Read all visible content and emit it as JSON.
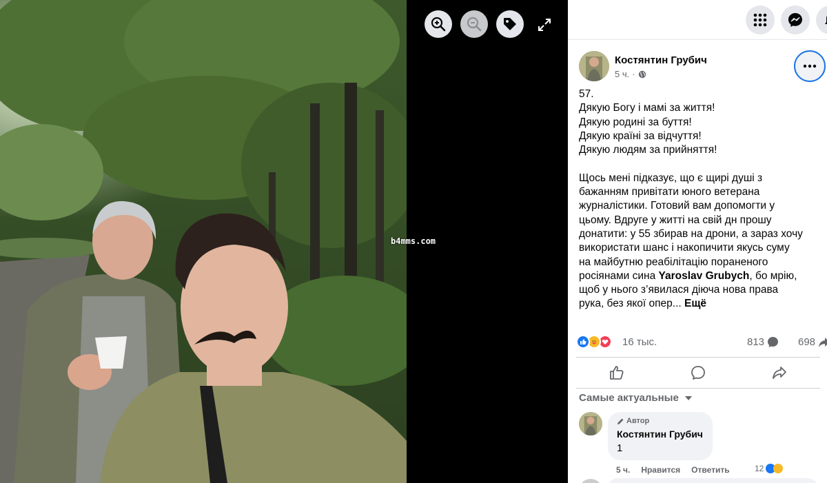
{
  "viewer": {
    "watermark": "b4mms.com",
    "controls": {
      "zoom_in": "zoom-in-icon",
      "zoom_out": "zoom-out-icon",
      "tag": "tag-icon",
      "fullscreen": "fullscreen-icon"
    }
  },
  "topbar": {
    "menu_icon": "grid-menu-icon",
    "messenger_icon": "messenger-icon",
    "notifications_icon": "bell-icon"
  },
  "post": {
    "author": "Костянтин Грубич",
    "time": "5 ч.",
    "privacy_icon": "globe-icon",
    "text_lines": [
      "57.",
      "Дякую Богу і мамі за життя!",
      "Дякую родині за буття!",
      "Дякую країні за відчуття!",
      "Дякую людям за прийняття!",
      "",
      "Щось мені підказує, що є щирі душі з",
      "бажанням привітати юного ветерана",
      "журналістики. Готовий вам допомогти у",
      "цьому. Вдруге у житті на свій дн прошу",
      "донатити: у 55 збирав на дрони, а зараз хочу",
      "використати шанс і накопичити якусь суму",
      "на майбутню реабілітацію пораненого"
    ],
    "line_mention_pre": "росіянами сина ",
    "mention": "Yaroslav Grubych",
    "line_mention_post": ", бо мрію,",
    "text_lines_tail": [
      "щоб у нього з’явилася діюча нова права"
    ],
    "last_line": "рука, без якої опер...",
    "see_more": "Ещё"
  },
  "stats": {
    "reactions": "16 тыс.",
    "comments": "813",
    "shares": "698",
    "reaction_types": [
      "like",
      "care",
      "love"
    ]
  },
  "actions": {
    "like_icon": "like-icon",
    "comment_icon": "comment-icon",
    "share_icon": "share-icon"
  },
  "comments": {
    "sort_label": "Самые актуальные",
    "items": [
      {
        "badge": "Автор",
        "author": "Костянтин Грубич",
        "text": "1",
        "time": "5 ч.",
        "like": "Нравится",
        "reply": "Ответить",
        "reactions": "12"
      }
    ]
  },
  "colors": {
    "accent": "#1b74e4",
    "text": "#050505",
    "secondary": "#65676b",
    "bubble": "#f0f2f5"
  }
}
